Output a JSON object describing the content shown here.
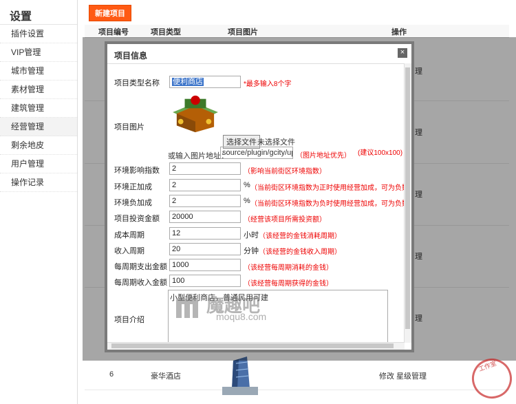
{
  "sidebar": {
    "title": "设置",
    "items": [
      {
        "label": "插件设置"
      },
      {
        "label": "VIP管理"
      },
      {
        "label": "城市管理"
      },
      {
        "label": "素材管理"
      },
      {
        "label": "建筑管理"
      },
      {
        "label": "经营管理"
      },
      {
        "label": "剩余地皮"
      },
      {
        "label": "用户管理"
      },
      {
        "label": "操作记录"
      }
    ]
  },
  "main": {
    "new_button": "新建项目",
    "columns": [
      "项目编号",
      "项目类型",
      "项目图片",
      "操作"
    ],
    "row6": {
      "id": "6",
      "type": "豪华酒店",
      "ops": "修改 星级管理"
    },
    "partial_ops": [
      "理",
      "理",
      "理",
      "理",
      "理",
      "理"
    ]
  },
  "dialog": {
    "title": "项目信息",
    "close": "×",
    "fields": {
      "type_name": {
        "label": "项目类型名称",
        "value": "便利商店",
        "hint": "*最多输入8个字"
      },
      "image": {
        "label": "项目图片",
        "choose": "选择文件",
        "no_file": "未选择文件",
        "url_label": "或输入图片地址：",
        "url_value": "source/plugin/gcity/up",
        "url_hint": "（图片地址优先）",
        "size_hint": "(建议100x100)"
      },
      "env_index": {
        "label": "环境影响指数",
        "value": "2",
        "hint": "（影响当前街区环境指数）"
      },
      "env_pos": {
        "label": "环境正加成",
        "value": "2",
        "unit": "%",
        "hint": "（当前街区环境指数为正时使用经营加成，可为负数）"
      },
      "env_neg": {
        "label": "环境负加成",
        "value": "2",
        "unit": "%",
        "hint": "（当前街区环境指数为负时使用经营加成，可为负数）"
      },
      "invest": {
        "label": "项目投资金额",
        "value": "20000",
        "hint": "（经营该项目所需投资额）"
      },
      "cost_cycle": {
        "label": "成本周期",
        "value": "12",
        "unit": "小时",
        "hint": "（该经营的金钱消耗周期）"
      },
      "income_cycle": {
        "label": "收入周期",
        "value": "20",
        "unit": "分钟",
        "hint": "（该经营的金钱收入周期）"
      },
      "cycle_cost": {
        "label": "每周期支出金额",
        "value": "1000",
        "hint": "（该经营每周期消耗的金钱）"
      },
      "cycle_income": {
        "label": "每周期收入金额",
        "value": "100",
        "hint": "（该经营每周期获得的金钱）"
      },
      "intro": {
        "label": "项目介绍",
        "value": "小型便利商店，普通民用可建"
      }
    }
  },
  "watermark": {
    "text": "魔趣吧",
    "url": "moqu8.com"
  },
  "stamp": {
    "text": "工作室"
  }
}
